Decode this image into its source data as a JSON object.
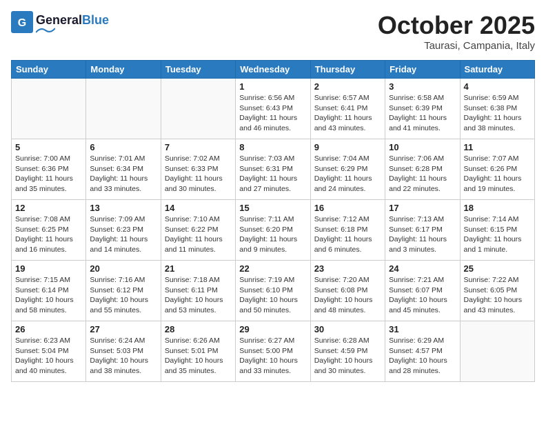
{
  "header": {
    "logo_general": "General",
    "logo_blue": "Blue",
    "title": "October 2025",
    "subtitle": "Taurasi, Campania, Italy"
  },
  "days_of_week": [
    "Sunday",
    "Monday",
    "Tuesday",
    "Wednesday",
    "Thursday",
    "Friday",
    "Saturday"
  ],
  "weeks": [
    [
      {
        "day": "",
        "info": ""
      },
      {
        "day": "",
        "info": ""
      },
      {
        "day": "",
        "info": ""
      },
      {
        "day": "1",
        "info": "Sunrise: 6:56 AM\nSunset: 6:43 PM\nDaylight: 11 hours and 46 minutes."
      },
      {
        "day": "2",
        "info": "Sunrise: 6:57 AM\nSunset: 6:41 PM\nDaylight: 11 hours and 43 minutes."
      },
      {
        "day": "3",
        "info": "Sunrise: 6:58 AM\nSunset: 6:39 PM\nDaylight: 11 hours and 41 minutes."
      },
      {
        "day": "4",
        "info": "Sunrise: 6:59 AM\nSunset: 6:38 PM\nDaylight: 11 hours and 38 minutes."
      }
    ],
    [
      {
        "day": "5",
        "info": "Sunrise: 7:00 AM\nSunset: 6:36 PM\nDaylight: 11 hours and 35 minutes."
      },
      {
        "day": "6",
        "info": "Sunrise: 7:01 AM\nSunset: 6:34 PM\nDaylight: 11 hours and 33 minutes."
      },
      {
        "day": "7",
        "info": "Sunrise: 7:02 AM\nSunset: 6:33 PM\nDaylight: 11 hours and 30 minutes."
      },
      {
        "day": "8",
        "info": "Sunrise: 7:03 AM\nSunset: 6:31 PM\nDaylight: 11 hours and 27 minutes."
      },
      {
        "day": "9",
        "info": "Sunrise: 7:04 AM\nSunset: 6:29 PM\nDaylight: 11 hours and 24 minutes."
      },
      {
        "day": "10",
        "info": "Sunrise: 7:06 AM\nSunset: 6:28 PM\nDaylight: 11 hours and 22 minutes."
      },
      {
        "day": "11",
        "info": "Sunrise: 7:07 AM\nSunset: 6:26 PM\nDaylight: 11 hours and 19 minutes."
      }
    ],
    [
      {
        "day": "12",
        "info": "Sunrise: 7:08 AM\nSunset: 6:25 PM\nDaylight: 11 hours and 16 minutes."
      },
      {
        "day": "13",
        "info": "Sunrise: 7:09 AM\nSunset: 6:23 PM\nDaylight: 11 hours and 14 minutes."
      },
      {
        "day": "14",
        "info": "Sunrise: 7:10 AM\nSunset: 6:22 PM\nDaylight: 11 hours and 11 minutes."
      },
      {
        "day": "15",
        "info": "Sunrise: 7:11 AM\nSunset: 6:20 PM\nDaylight: 11 hours and 9 minutes."
      },
      {
        "day": "16",
        "info": "Sunrise: 7:12 AM\nSunset: 6:18 PM\nDaylight: 11 hours and 6 minutes."
      },
      {
        "day": "17",
        "info": "Sunrise: 7:13 AM\nSunset: 6:17 PM\nDaylight: 11 hours and 3 minutes."
      },
      {
        "day": "18",
        "info": "Sunrise: 7:14 AM\nSunset: 6:15 PM\nDaylight: 11 hours and 1 minute."
      }
    ],
    [
      {
        "day": "19",
        "info": "Sunrise: 7:15 AM\nSunset: 6:14 PM\nDaylight: 10 hours and 58 minutes."
      },
      {
        "day": "20",
        "info": "Sunrise: 7:16 AM\nSunset: 6:12 PM\nDaylight: 10 hours and 55 minutes."
      },
      {
        "day": "21",
        "info": "Sunrise: 7:18 AM\nSunset: 6:11 PM\nDaylight: 10 hours and 53 minutes."
      },
      {
        "day": "22",
        "info": "Sunrise: 7:19 AM\nSunset: 6:10 PM\nDaylight: 10 hours and 50 minutes."
      },
      {
        "day": "23",
        "info": "Sunrise: 7:20 AM\nSunset: 6:08 PM\nDaylight: 10 hours and 48 minutes."
      },
      {
        "day": "24",
        "info": "Sunrise: 7:21 AM\nSunset: 6:07 PM\nDaylight: 10 hours and 45 minutes."
      },
      {
        "day": "25",
        "info": "Sunrise: 7:22 AM\nSunset: 6:05 PM\nDaylight: 10 hours and 43 minutes."
      }
    ],
    [
      {
        "day": "26",
        "info": "Sunrise: 6:23 AM\nSunset: 5:04 PM\nDaylight: 10 hours and 40 minutes."
      },
      {
        "day": "27",
        "info": "Sunrise: 6:24 AM\nSunset: 5:03 PM\nDaylight: 10 hours and 38 minutes."
      },
      {
        "day": "28",
        "info": "Sunrise: 6:26 AM\nSunset: 5:01 PM\nDaylight: 10 hours and 35 minutes."
      },
      {
        "day": "29",
        "info": "Sunrise: 6:27 AM\nSunset: 5:00 PM\nDaylight: 10 hours and 33 minutes."
      },
      {
        "day": "30",
        "info": "Sunrise: 6:28 AM\nSunset: 4:59 PM\nDaylight: 10 hours and 30 minutes."
      },
      {
        "day": "31",
        "info": "Sunrise: 6:29 AM\nSunset: 4:57 PM\nDaylight: 10 hours and 28 minutes."
      },
      {
        "day": "",
        "info": ""
      }
    ]
  ]
}
